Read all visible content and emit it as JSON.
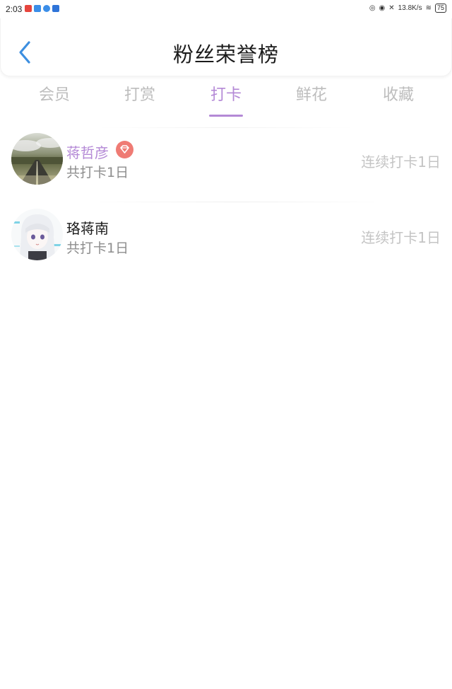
{
  "status_bar": {
    "time": "2:03",
    "network_speed": "13.8K/s",
    "battery": "75"
  },
  "header": {
    "title": "粉丝荣誉榜"
  },
  "tabs": [
    {
      "label": "会员"
    },
    {
      "label": "打赏"
    },
    {
      "label": "打卡"
    },
    {
      "label": "鲜花"
    },
    {
      "label": "收藏"
    }
  ],
  "active_tab": "打卡",
  "fans": [
    {
      "name": "蒋哲彦",
      "summary": "共打卡1日",
      "streak": "连续打卡1日",
      "badge_icon": "diamond-icon"
    },
    {
      "name": "珞蒋南",
      "summary": "共打卡1日",
      "streak": "连续打卡1日"
    }
  ],
  "colors": {
    "accent": "#b489d6",
    "back_icon": "#3d8fe0",
    "inactive_tab": "#bdbdbd",
    "badge": "#ef7b74"
  }
}
